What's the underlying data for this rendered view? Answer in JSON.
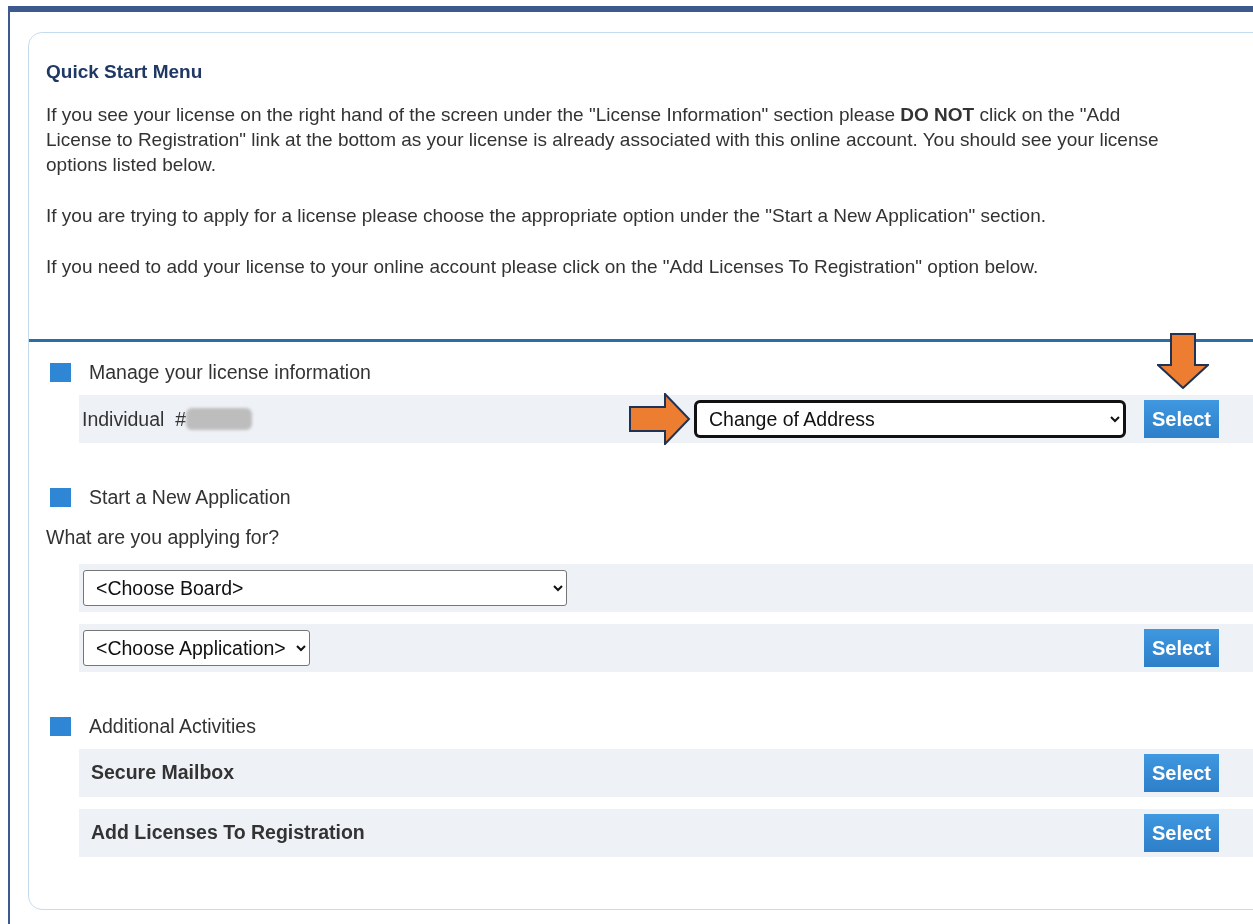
{
  "title": "Quick Start Menu",
  "intro": [
    "If you see your license on the right hand of the screen under the \"License Information\" section please **DO NOT** click on the \"Add License to Registration\" link at the bottom as your license is already associated with this online account. You should see your license options listed below.",
    "If you are trying to apply for a license please choose the appropriate option under the \"Start a New Application\" section.",
    "If you need to add your license to your online account please click on the \"Add Licenses To Registration\" option below."
  ],
  "sections": [
    {
      "heading": "Manage your license information",
      "rows": [
        {
          "kind": "license",
          "label": "Individual  #",
          "select": {
            "value": "Change of Address",
            "highlighted": true
          },
          "button": "Select"
        }
      ]
    },
    {
      "heading": "Start a New Application",
      "prompt": "What are you applying for?",
      "rows": [
        {
          "kind": "select",
          "select": {
            "value": "<Choose Board>",
            "highlighted": false
          }
        },
        {
          "kind": "select",
          "select": {
            "value": "<Choose Application>",
            "highlighted": false
          },
          "button": "Select"
        }
      ]
    },
    {
      "heading": "Additional Activities",
      "rows": [
        {
          "kind": "action",
          "label": "Secure Mailbox",
          "button": "Select"
        },
        {
          "kind": "action",
          "label": "Add Licenses To Registration",
          "button": "Select"
        }
      ]
    }
  ]
}
